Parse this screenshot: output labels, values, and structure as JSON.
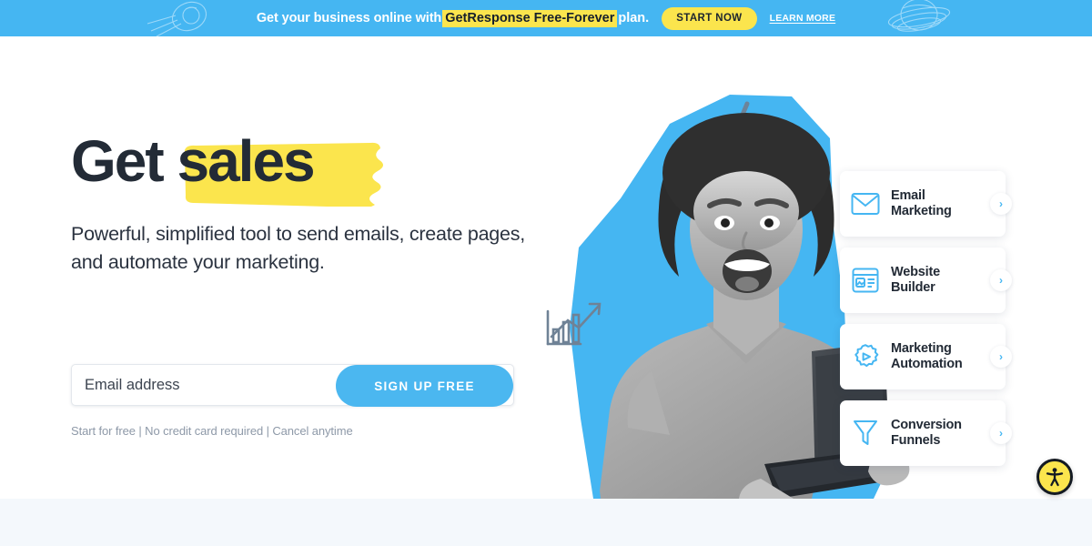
{
  "promo": {
    "text_before": "Get your business online with",
    "highlight": "GetResponse Free-Forever",
    "text_after": "plan.",
    "cta_label": "START NOW",
    "link_label": "LEARN MORE",
    "bg_color": "#45b6f2",
    "highlight_color": "#fbe54d",
    "decorations": [
      "comet-icon",
      "planet-icon"
    ]
  },
  "hero": {
    "headline_1": "Get",
    "headline_2": "sales",
    "highlight_color": "#fbe54d",
    "subheading": "Powerful, simplified tool to send emails,\ncreate pages, and automate your marketing.",
    "form": {
      "email_placeholder": "Email address",
      "email_value": "",
      "submit_label": "SIGN UP FREE",
      "submit_color": "#4bb7f0"
    },
    "fineprint": "Start for free | No credit card required | Cancel anytime",
    "image_alt": "smiling-woman-holding-laptop",
    "accent_color": "#45b6f2"
  },
  "cards": [
    {
      "label": "Email\nMarketing",
      "icon": "envelope-icon",
      "chevron": "›"
    },
    {
      "label": "Website\nBuilder",
      "icon": "browser-layout-icon",
      "chevron": "›"
    },
    {
      "label": "Marketing\nAutomation",
      "icon": "gear-play-icon",
      "chevron": "›"
    },
    {
      "label": "Conversion\nFunnels",
      "icon": "funnel-icon",
      "chevron": "›"
    }
  ],
  "accessibility": {
    "icon": "accessibility-person-icon",
    "bg_color": "#fbe54d"
  }
}
